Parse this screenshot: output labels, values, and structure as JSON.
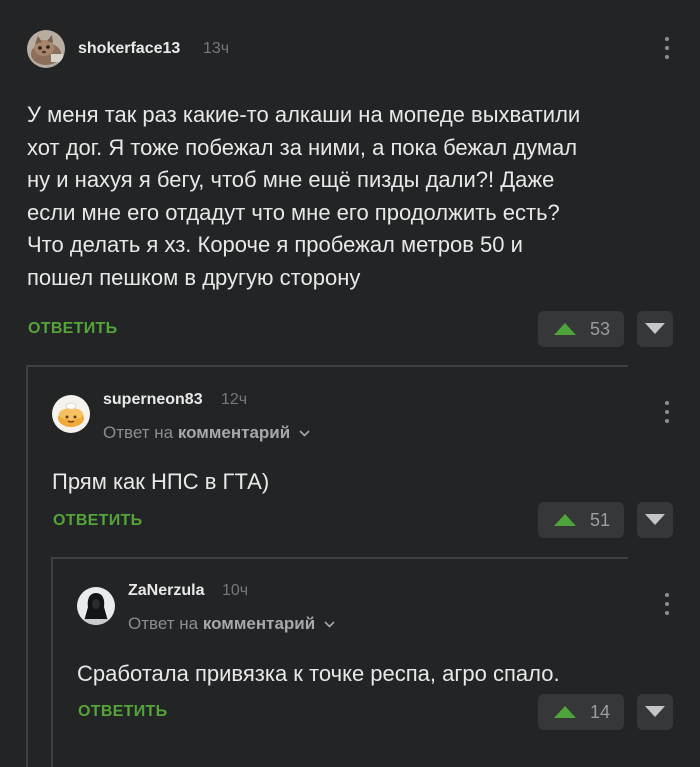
{
  "comments": [
    {
      "username": "shokerface13",
      "time": "13ч",
      "text": "У меня так раз какие-то алкаши на мопеде выхватили\nхот дог. Я тоже побежал за ними, а пока бежал думал\nну и нахуя я бегу, чтоб мне ещё пизды дали?! Даже\nесли мне его отдадут что мне его продолжить есть?\nЧто делать я хз. Короче я пробежал метров 50 и\nпошел пешком в другую сторону",
      "reply_label": "ОТВЕТИТЬ",
      "votes": "53",
      "avatar_icon": "cat-avatar-icon"
    },
    {
      "username": "superneon83",
      "time": "12ч",
      "reply_prefix": "Ответ на",
      "reply_target": "комментарий",
      "text": "Прям как НПС в ГТА)",
      "reply_label": "ОТВЕТИТЬ",
      "votes": "51",
      "avatar_icon": "bun-avatar-icon"
    },
    {
      "username": "ZaNerzula",
      "time": "10ч",
      "reply_prefix": "Ответ на",
      "reply_target": "комментарий",
      "text": "Сработала привязка к точке респа, агро спало.",
      "reply_label": "ОТВЕТИТЬ",
      "votes": "14",
      "avatar_icon": "hooded-figure-avatar-icon"
    }
  ],
  "colors": {
    "background": "#222425",
    "reply_green": "#55a43a",
    "vote_box": "#353739",
    "upvote_green": "#4ea33a"
  }
}
